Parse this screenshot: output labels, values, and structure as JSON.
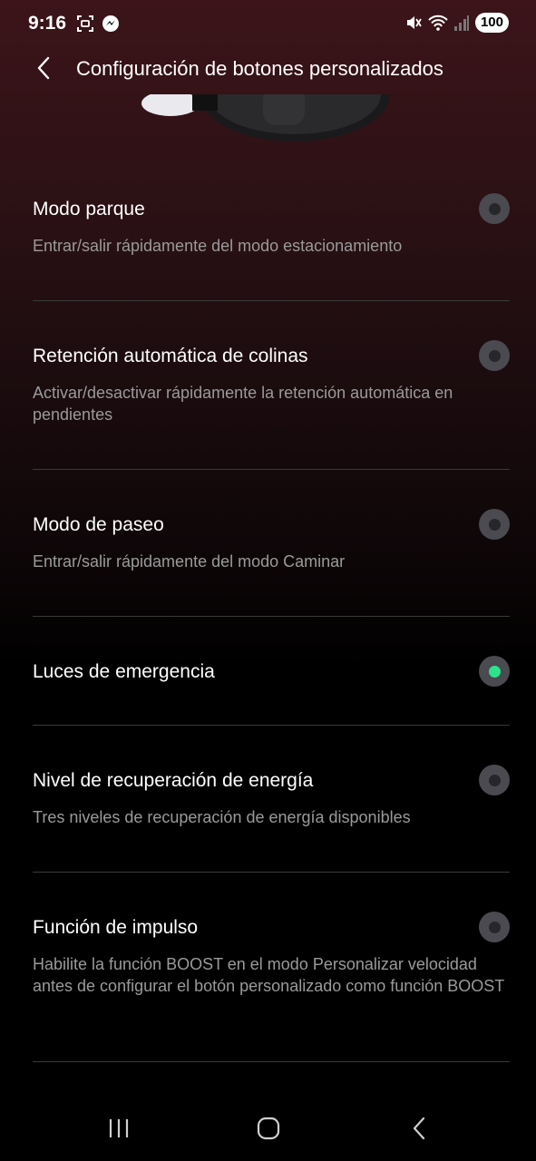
{
  "status_bar": {
    "time": "9:16",
    "battery": "100"
  },
  "header": {
    "title": "Configuración de botones personalizados"
  },
  "options": [
    {
      "title": "Modo parque",
      "description": "Entrar/salir rápidamente del modo estacionamiento",
      "selected": false
    },
    {
      "title": "Retención automática de colinas",
      "description": "Activar/desactivar rápidamente la retención automática en pendientes",
      "selected": false
    },
    {
      "title": "Modo de paseo",
      "description": "Entrar/salir rápidamente del modo Caminar",
      "selected": false
    },
    {
      "title": "Luces de emergencia",
      "description": "",
      "selected": true
    },
    {
      "title": "Nivel de recuperación de energía",
      "description": "Tres niveles de recuperación de energía disponibles",
      "selected": false
    },
    {
      "title": "Función de impulso",
      "description": "Habilite la función BOOST en el modo Personalizar velocidad antes de configurar el botón personalizado como función BOOST",
      "selected": false
    }
  ],
  "colors": {
    "accent": "#2ee28a",
    "description_text": "#9a9a9a",
    "divider": "#3a3a3a"
  }
}
